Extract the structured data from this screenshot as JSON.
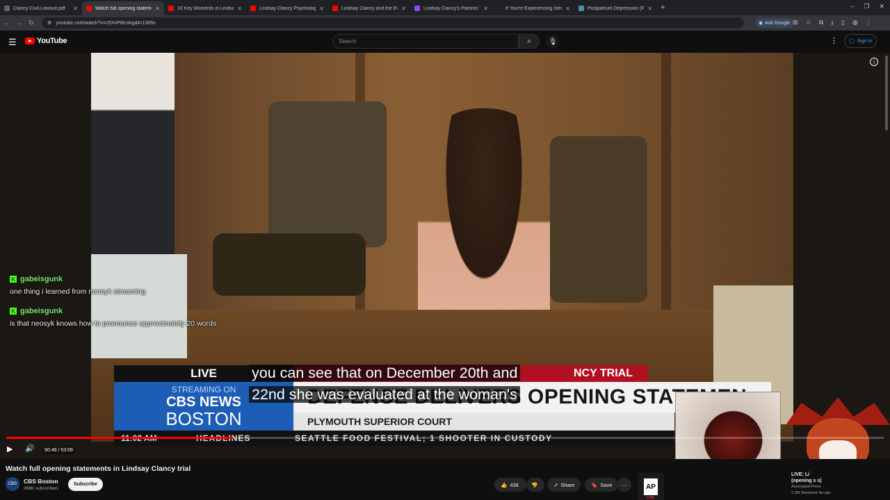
{
  "browser": {
    "tabs": [
      {
        "title": "Clancy-Civil-Lawsuit.pdf",
        "favicon_color": "#5f6368",
        "active": false
      },
      {
        "title": "Watch full opening statements",
        "favicon_color": "#ff0000",
        "active": true
      },
      {
        "title": "10 Key Moments in Lindsay Cla",
        "favicon_color": "#ff0000",
        "active": false
      },
      {
        "title": "Lindsay Clancy Psychologist De",
        "favicon_color": "#ff0000",
        "active": false
      },
      {
        "title": "Lindsay Clancy and the Eviden",
        "favicon_color": "#ff0000",
        "active": false
      },
      {
        "title": "Lindsay Clancy's Parents' $1 M",
        "favicon_color": "#9146ff",
        "active": false
      },
      {
        "title": "If You're Experiencing Intrusive",
        "favicon_color": "#202124",
        "active": false
      },
      {
        "title": "Postpartum Depression (PPD)",
        "favicon_color": "#4a90a4",
        "active": false
      }
    ],
    "new_tab": "+",
    "url": "youtube.com/watch?v=c5XvPt6csKg&t=1369s",
    "ask_google": "Ask Google"
  },
  "youtube": {
    "logo": "YouTube",
    "search_placeholder": "Search",
    "sign_in": "Sign in"
  },
  "video": {
    "chat": [
      {
        "user": "gabeisgunk",
        "text": "one thing i learned from neosyk streaming"
      },
      {
        "user": "gabeisgunk",
        "text": "is that neosyk knows how to pronounce approximately 20 words"
      }
    ],
    "lower_third": {
      "live": "LIVE",
      "streaming_on": "STREAMING ON",
      "network": "CBS NEWS",
      "city": "BOSTON",
      "banner": "NCY TRIAL",
      "headline": "DEFENSE DELIVERS OPENING STATEMEN",
      "court": "PLYMOUTH SUPERIOR COURT",
      "time": "11:02 AM",
      "headlines_label": "HEADLINES",
      "ticker": "SEATTLE FOOD FESTIVAL; 1 SHOOTER IN CUSTODY"
    },
    "captions": [
      "you can see that on December 20th and",
      "22nd she was evaluated at the woman's"
    ],
    "progress": 0.258,
    "time": "50:49 / 53:09"
  },
  "meta": {
    "title": "Watch full opening statements in Lindsay Clancy trial",
    "channel": "CBS Boston",
    "subscribers": "368K subscribers",
    "subscribe": "Subscribe",
    "likes": "436",
    "share": "Share",
    "save": "Save",
    "more": "···"
  },
  "sidebar_card": {
    "title_line1": "LIVE: Li",
    "title_line2": "(opening s         s)",
    "channel": "Associated Press",
    "stats": "2.3M   Streamed 4w ago"
  }
}
